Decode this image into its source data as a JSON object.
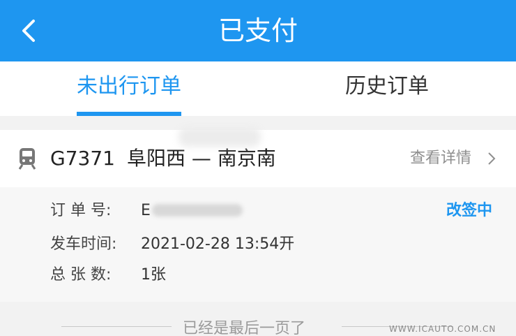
{
  "header": {
    "title": "已支付",
    "back_icon": "chevron-left-icon"
  },
  "tabs": [
    {
      "label": "未出行订单",
      "active": true
    },
    {
      "label": "历史订单",
      "active": false
    }
  ],
  "order": {
    "train_no": "G7371",
    "route": "阜阳西 — 南京南",
    "details_link": "查看详情",
    "status": "改签中",
    "order_no_label": "订 单 号:",
    "order_no_value": "E",
    "depart_label": "发车时间:",
    "depart_value": "2021-02-28   13:54开",
    "count_label": "总 张 数:",
    "count_value": "1张"
  },
  "footer": {
    "note": "已经是最后一页了"
  },
  "watermark": "WWW.ICAUTO.COM.CN",
  "colors": {
    "accent": "#1e96f0",
    "background": "#f2f2f2"
  }
}
